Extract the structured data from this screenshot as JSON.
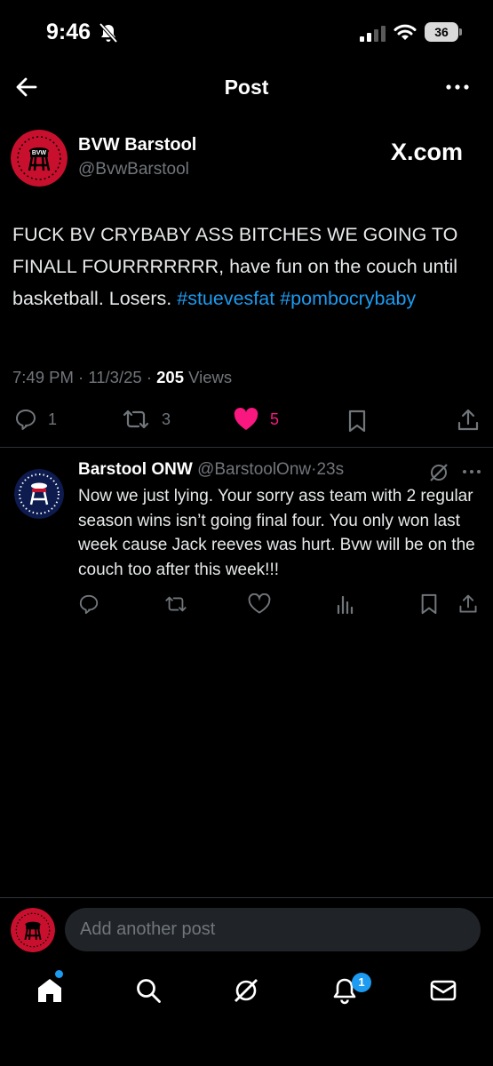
{
  "status_bar": {
    "time": "9:46",
    "battery": "36"
  },
  "header": {
    "title": "Post"
  },
  "post": {
    "author_name": "BVW Barstool",
    "author_handle": "@BvwBarstool",
    "source_badge": "X.com",
    "text_main": "FUCK BV CRYBABY ASS BITCHES WE GOING TO FINALL FOURRRRRRR, have fun on the couch until basketball. Losers.",
    "hashtag_1": "#stuevesfat",
    "hashtag_2": "#pombocrybaby",
    "timestamp": "7:49 PM · 11/3/25 · ",
    "views_count": "205",
    "views_label": " Views",
    "reply_count": "1",
    "repost_count": "3",
    "like_count": "5"
  },
  "reply": {
    "author_name": "Barstool ONW",
    "author_handle": "@BarstoolOnw",
    "time": "23s",
    "text": "Now we just lying. Your sorry ass team with 2 regular season wins isn’t going final four. You only won last week cause Jack reeves was hurt. Bvw will be on the couch too after this week!!!"
  },
  "compose": {
    "placeholder": "Add another post"
  },
  "tab_bar": {
    "notifications_badge": "1"
  },
  "colors": {
    "accent": "#1d9bf0",
    "like": "#f91880",
    "muted": "#71767b"
  }
}
